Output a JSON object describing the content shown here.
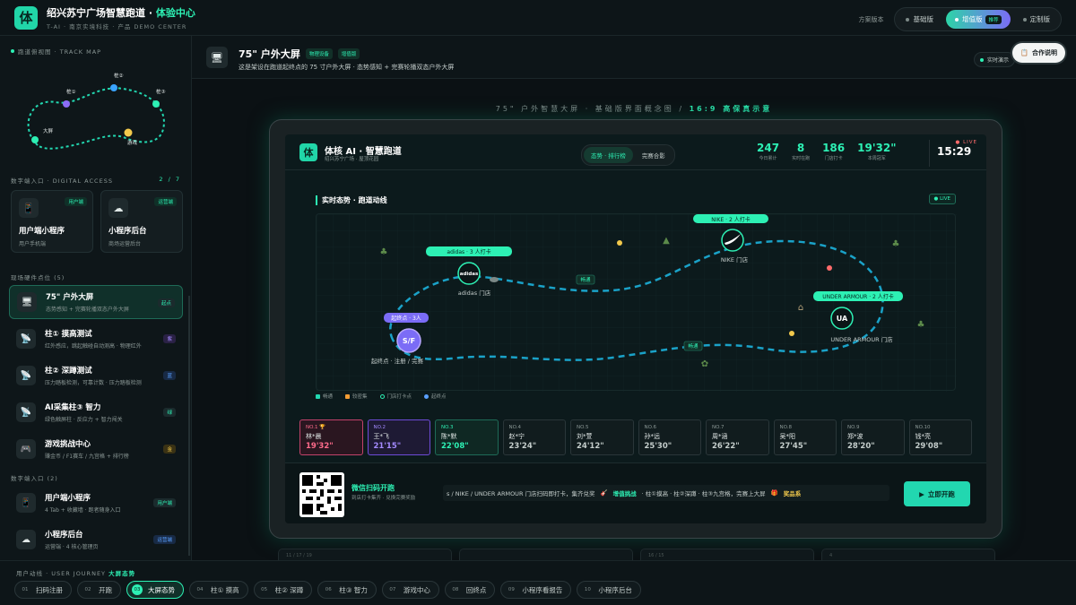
{
  "header": {
    "logo": "体",
    "title_main": "绍兴苏宁广场智慧跑道 · ",
    "title_highlight": "体验中心",
    "subtitle": "T-AI · 南京实境科技 · 产品 DEMO CENTER",
    "plan_label": "方案版本",
    "plans": [
      {
        "label": "基础版",
        "active": false
      },
      {
        "label": "增值版",
        "active": true,
        "tag": "推荐"
      },
      {
        "label": "定制版",
        "active": false
      }
    ]
  },
  "sidebar": {
    "track_map_title": "跑道俯视图 · TRACK MAP",
    "mini_map_labels": [
      "桩①",
      "桩②",
      "桩③",
      "大屏",
      "游戏"
    ],
    "access_title": "数字端入口 · DIGITAL ACCESS",
    "access_page": "2 / 7",
    "access_cards": [
      {
        "icon": "📱",
        "badge": "用户端",
        "title": "用户端小程序",
        "sub": "用户手机端"
      },
      {
        "icon": "☁",
        "badge": "运营端",
        "title": "小程序后台",
        "sub": "商场运营后台"
      }
    ],
    "hardware_title": "现场硬件点位 (5)",
    "hardware": [
      {
        "icon": "🖥",
        "title": "75\" 户外大屏",
        "sub": "态势感知 + 完赛轮播双态户外大屏",
        "badge": "起点"
      },
      {
        "icon": "📡",
        "title": "柱① 摸高测试",
        "sub": "红外感应，跳起触碰自动测高 · 物理红外",
        "badge": "紫"
      },
      {
        "icon": "📡",
        "title": "柱② 深蹲测试",
        "sub": "压力踏板检测，可靠计数 · 压力踏板检测",
        "badge": "蓝"
      },
      {
        "icon": "📡",
        "title": "AI采集柱③ 智力",
        "sub": "绿色触屏柱 · 反应力 + 智力闯关",
        "badge": "绿"
      },
      {
        "icon": "🎮",
        "title": "游戏挑战中心",
        "sub": "赚金币 / F1赛车 / 九宫格 + 排行榜",
        "badge": "金"
      }
    ],
    "digital_title": "数字端入口 (2)",
    "digital": [
      {
        "icon": "📱",
        "title": "用户端小程序",
        "sub": "4 Tab + 收藏墙 · 跑者随身入口",
        "badge": "用户端"
      },
      {
        "icon": "☁",
        "title": "小程序后台",
        "sub": "运营端 · 4 核心管理页",
        "badge": "运营端"
      }
    ]
  },
  "main": {
    "icon": "🖥",
    "title": "75\" 户外大屏",
    "tags": [
      "物理设备",
      "增值版"
    ],
    "desc": "这是架设在跑道起终点的 75 寸户外大屏 · 态势感知 + 完赛轮播双态户外大屏",
    "realtime_demo": "实时演示",
    "coop_button": "合作说明",
    "screen_caption": "75\" 户外智慧大屏 · 基础版界面概念图 / ",
    "screen_caption_hl": "16:9 高保真示意"
  },
  "screen": {
    "logo": "体",
    "title": "体核 AI · 智慧跑道",
    "subtitle": "绍兴苏宁广场 · 屋顶花园",
    "tabs": [
      {
        "label": "态势 · 排行榜",
        "active": true
      },
      {
        "label": "完赛合影",
        "active": false
      }
    ],
    "stats": [
      {
        "value": "247",
        "key": "今日累计"
      },
      {
        "value": "8",
        "key": "实时在跑"
      },
      {
        "value": "186",
        "key": "门店打卡"
      },
      {
        "value": "19'32\"",
        "key": "本周冠军"
      }
    ],
    "live": "● LIVE",
    "time": "15:29",
    "map_title": "实时态势 · 跑道动线",
    "live_tag": "● LIVE",
    "map": {
      "store_adidas_tag": "adidas · 3 人打卡",
      "store_adidas_logo": "adidas",
      "store_adidas_label": "adidas 门店",
      "store_nike_tag": "NIKE · 2 人打卡",
      "store_nike_label": "NIKE 门店",
      "store_ua_tag": "UNDER ARMOUR · 2 人打卡",
      "store_ua_logo": "UA",
      "store_ua_label": "UNDER ARMOUR 门店",
      "start_tag": "起终点 · 3人",
      "start_logo": "S/F",
      "start_label": "起终点 · 注册 / 完赛",
      "seg_label_1": "畅通",
      "seg_label_2": "畅通",
      "congested_label": "较密集"
    },
    "legend": [
      {
        "label": "畅通",
        "color": "#22d7b0"
      },
      {
        "label": "较密集",
        "color": "#f39c34"
      },
      {
        "label": "门店打卡点",
        "color": "#2df0b4"
      },
      {
        "label": "起终点",
        "color": "#5aa0ff"
      }
    ],
    "ranks": [
      {
        "no": "NO.1 🏆",
        "name": "林*晨",
        "time": "19'32\""
      },
      {
        "no": "NO.2",
        "name": "王*飞",
        "time": "21'15\""
      },
      {
        "no": "NO.3",
        "name": "陈*默",
        "time": "22'08\""
      },
      {
        "no": "NO.4",
        "name": "赵*宁",
        "time": "23'24\""
      },
      {
        "no": "NO.5",
        "name": "刘*萱",
        "time": "24'12\""
      },
      {
        "no": "NO.6",
        "name": "孙*远",
        "time": "25'30\""
      },
      {
        "no": "NO.7",
        "name": "周*涵",
        "time": "26'22\""
      },
      {
        "no": "NO.8",
        "name": "吴*阳",
        "time": "27'45\""
      },
      {
        "no": "NO.9",
        "name": "郑*波",
        "time": "28'20\""
      },
      {
        "no": "NO.10",
        "name": "钱*亮",
        "time": "29'08\""
      }
    ],
    "qr_title": "微信扫码开跑",
    "qr_sub": "到店打卡集齐 · 兑换完赛奖励",
    "ticker_1": "s / NIKE / UNDER ARMOUR 门店扫码即打卡，集齐兑奖",
    "ticker_2": "增值挑战",
    "ticker_3": "· 柱①摸高 · 柱②深蹲 · 柱③九宫格，完赛上大屏",
    "ticker_4": "奖品系",
    "go_button": "立即开跑"
  },
  "ghost_cards": [
    "11 / 17 / 19",
    "",
    "16 / 15",
    "4"
  ],
  "journey": {
    "title": "用户动线 · USER JOURNEY",
    "title_hl": "大屏态势",
    "steps": [
      {
        "n": "01",
        "label": "扫码注册",
        "active": false
      },
      {
        "n": "02",
        "label": "开跑",
        "active": false
      },
      {
        "n": "03",
        "label": "大屏态势",
        "active": true
      },
      {
        "n": "04",
        "label": "柱① 摸高",
        "active": false
      },
      {
        "n": "05",
        "label": "柱② 深蹲",
        "active": false
      },
      {
        "n": "06",
        "label": "柱③ 智力",
        "active": false
      },
      {
        "n": "07",
        "label": "游戏中心",
        "active": false
      },
      {
        "n": "08",
        "label": "回终点",
        "active": false
      },
      {
        "n": "09",
        "label": "小程序看报告",
        "active": false
      },
      {
        "n": "10",
        "label": "小程序后台",
        "active": false
      }
    ]
  }
}
